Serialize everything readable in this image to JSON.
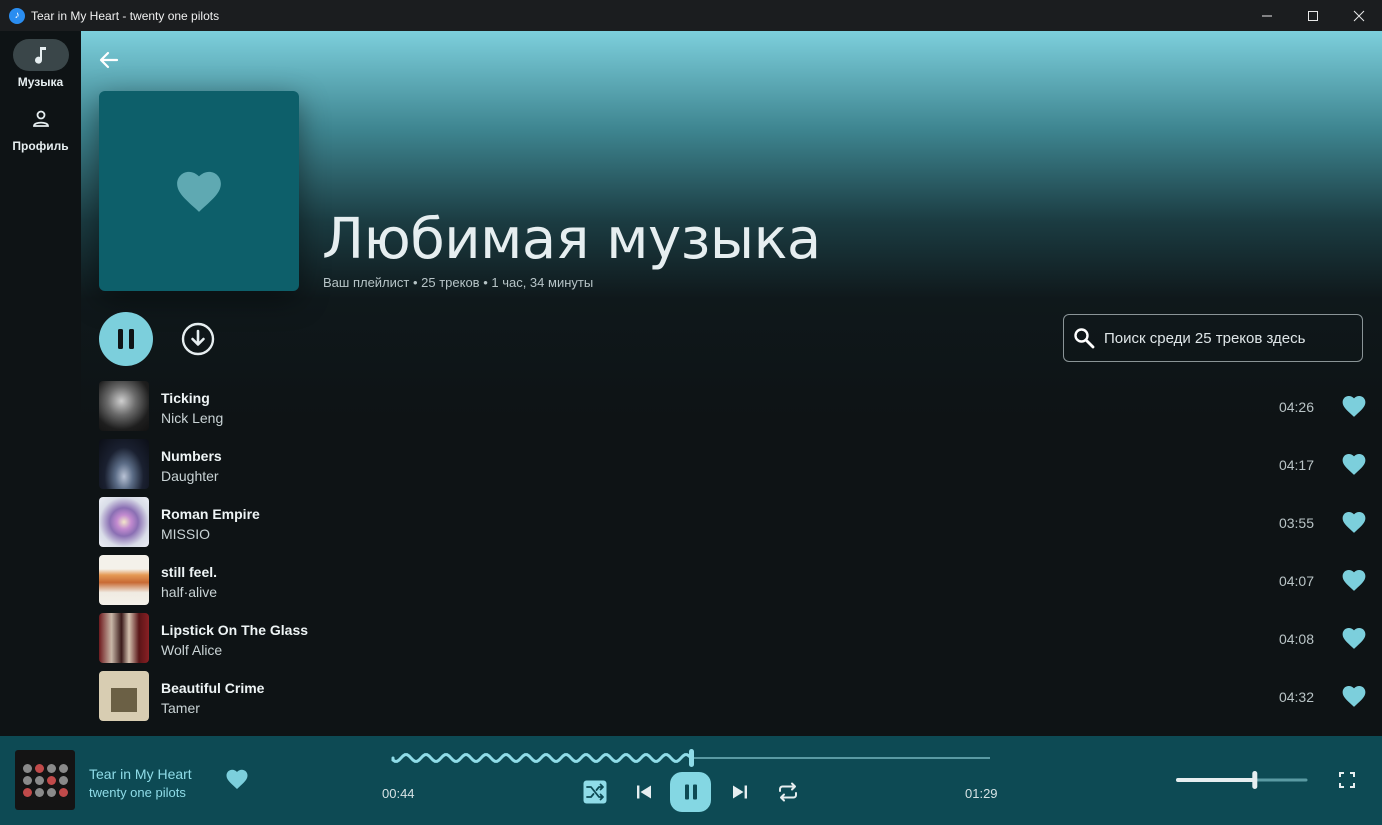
{
  "window": {
    "title": "Tear in My Heart - twenty one pilots",
    "app_icon": "music-note-icon"
  },
  "sidebar": {
    "items": [
      {
        "label": "Музыка",
        "icon": "music-note-icon",
        "active": true
      },
      {
        "label": "Профиль",
        "icon": "person-icon",
        "active": false
      }
    ]
  },
  "playlist": {
    "title": "Любимая музыка",
    "meta": "Ваш плейлист • 25 треков • 1 час, 34 минуты",
    "cover_icon": "heart-icon",
    "cover_color": "#0d5f6a"
  },
  "search": {
    "placeholder": "Поиск среди 25 треков здесь"
  },
  "tracks": [
    {
      "title": "Ticking",
      "artist": "Nick Leng",
      "duration": "04:26"
    },
    {
      "title": "Numbers",
      "artist": "Daughter",
      "duration": "04:17"
    },
    {
      "title": "Roman Empire",
      "artist": "MISSIO",
      "duration": "03:55"
    },
    {
      "title": "still feel.",
      "artist": "half·alive",
      "duration": "04:07"
    },
    {
      "title": "Lipstick On The Glass",
      "artist": "Wolf Alice",
      "duration": "04:08"
    },
    {
      "title": "Beautiful Crime",
      "artist": "Tamer",
      "duration": "04:32"
    }
  ],
  "player": {
    "title": "Tear in My Heart",
    "artist": "twenty one pilots",
    "current_time": "00:44",
    "total_time": "01:29",
    "progress": 0.5,
    "volume": 0.6,
    "liked": true
  },
  "colors": {
    "accent": "#7ccfdc",
    "player_bg": "#0d4a54",
    "background": "#0e1315"
  }
}
